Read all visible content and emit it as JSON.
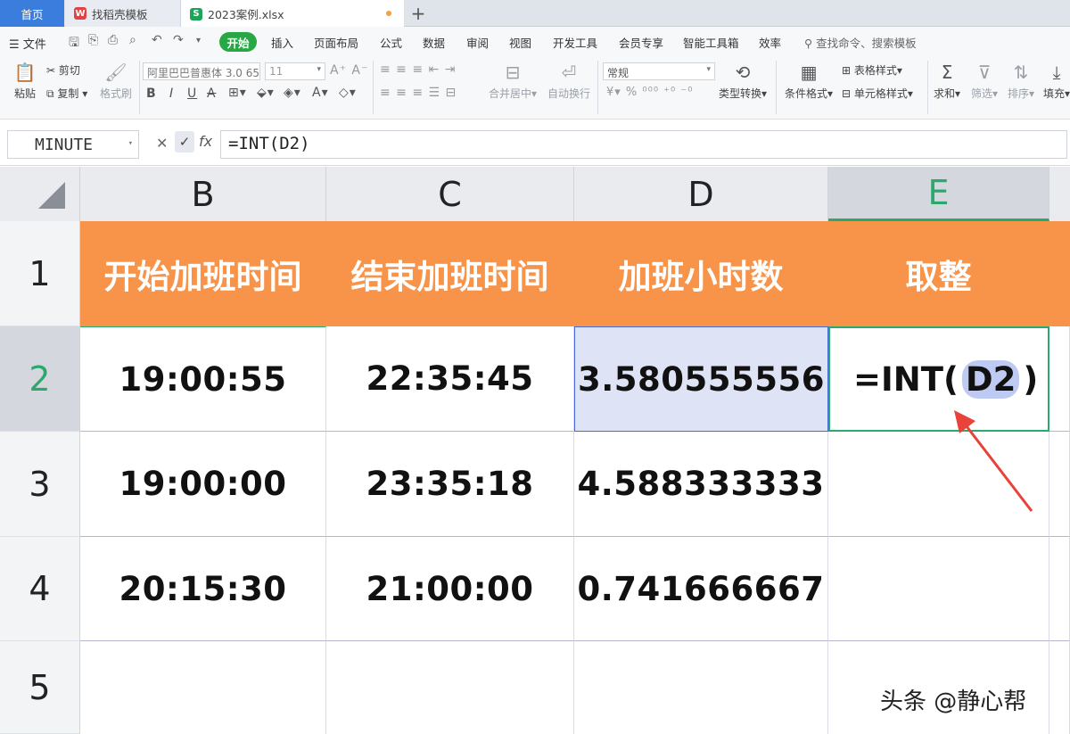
{
  "tabs": {
    "home": "首页",
    "template": "找稻壳模板",
    "file": "2023案例.xlsx",
    "add": "+"
  },
  "menu": {
    "file": "文件",
    "items": [
      "开始",
      "插入",
      "页面布局",
      "公式",
      "数据",
      "审阅",
      "视图",
      "开发工具",
      "会员专享",
      "智能工具箱",
      "效率"
    ],
    "search": "查找命令、搜索模板"
  },
  "ribbon": {
    "paste": "粘贴",
    "cut": "剪切",
    "copy": "复制",
    "format_painter": "格式刷",
    "font": "阿里巴巴普惠体 3.0 65",
    "font_size": "11",
    "number_format": "常规",
    "merge": "合并居中",
    "wrap": "自动换行",
    "type_convert": "类型转换",
    "cond_format": "条件格式",
    "table_style": "表格样式",
    "cell_style": "单元格样式",
    "sum": "求和",
    "filter": "筛选",
    "sort": "排序",
    "fill": "填充"
  },
  "formula_bar": {
    "name_box": "MINUTE",
    "fx": "fx",
    "formula": "=INT(D2)"
  },
  "grid": {
    "columns": [
      "B",
      "C",
      "D",
      "E"
    ],
    "rows": [
      "1",
      "2",
      "3",
      "4",
      "5"
    ],
    "header_row": [
      "开始加班时间",
      "结束加班时间",
      "加班小时数",
      "取整"
    ],
    "data": [
      [
        "19:00:55",
        "22:35:45",
        "3.580555556"
      ],
      [
        "19:00:00",
        "23:35:18",
        "4.588333333"
      ],
      [
        "20:15:30",
        "21:00:00",
        "0.741666667"
      ]
    ],
    "edit_cell": {
      "prefix": "=INT(",
      "ref": "D2",
      "suffix": ")"
    }
  },
  "watermark": "头条 @静心帮",
  "colors": {
    "header_fill": "#f7944a",
    "active": "#2ba96b",
    "selection": "#4a69d6",
    "arrow": "#e8423a"
  }
}
